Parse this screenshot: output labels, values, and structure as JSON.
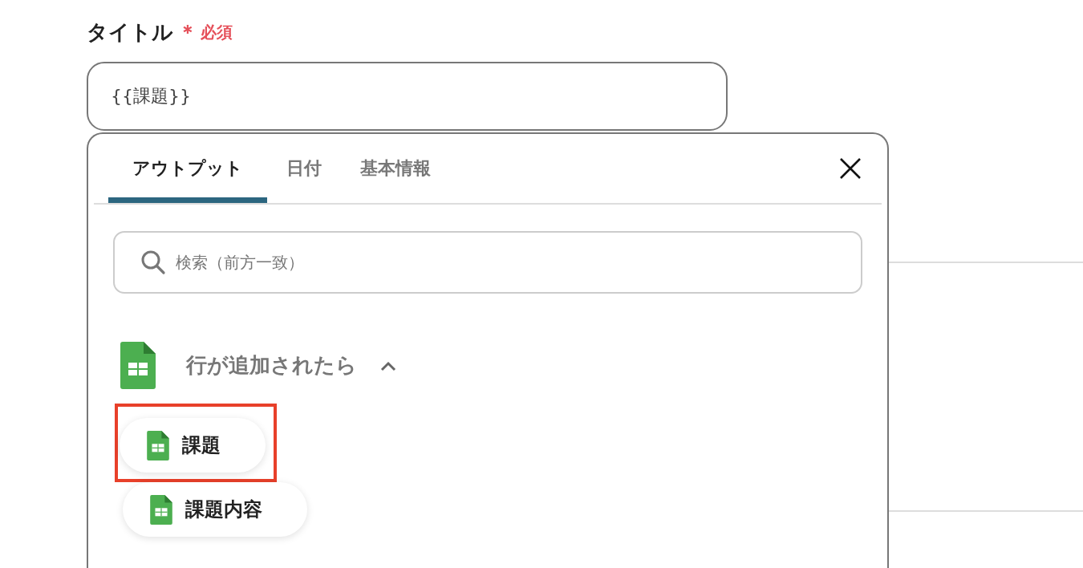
{
  "field": {
    "label": "タイトル",
    "required_mark": "＊",
    "required_text": "必須",
    "value": "{{課題}}"
  },
  "popover": {
    "tabs": [
      {
        "label": "アウトプット",
        "selected": true
      },
      {
        "label": "日付",
        "selected": false
      },
      {
        "label": "基本情報",
        "selected": false
      }
    ],
    "search": {
      "placeholder": "検索（前方一致）"
    },
    "group": {
      "title": "行が追加されたら",
      "expanded": true,
      "items": [
        {
          "label": "課題",
          "highlighted": true
        },
        {
          "label": "課題内容",
          "highlighted": false
        }
      ]
    }
  }
}
